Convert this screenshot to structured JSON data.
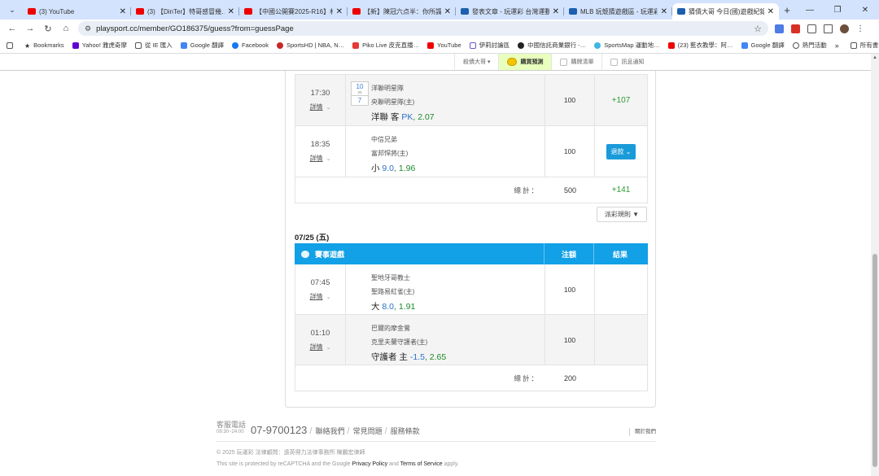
{
  "browser": {
    "tabs": [
      {
        "title": "(3) YouTube",
        "icon": "youtube-icon"
      },
      {
        "title": "(3) 【DinTer】特哥感冒幾…",
        "icon": "youtube-icon"
      },
      {
        "title": "【中國公開賽2025-R16】林俊…",
        "icon": "youtube-icon"
      },
      {
        "title": "【新】陳冠六点半：你所謂打…",
        "icon": "youtube-icon"
      },
      {
        "title": "發表文章 - 玩運彩 台灣運動彩…",
        "icon": "playsport-icon"
      },
      {
        "title": "MLB 玩競猜遊戲區 - 玩運彩…",
        "icon": "playsport-icon"
      },
      {
        "title": "猜債大哥 今日(國)遊戲紀錄 - 玩…",
        "icon": "playsport-icon",
        "active": true
      }
    ],
    "new_tab": "+",
    "url": "playsport.cc/member/GO186375/guess?from=guessPage",
    "bookmarks": [
      "Bookmarks",
      "Yahoo! 雅虎奇摩",
      "從 IE 匯入",
      "Google 翻譯",
      "Facebook",
      "SportsHD | NBA, N…",
      "Piko Live 皮克直播…",
      "YouTube",
      "伊莉討論區",
      "中國信託商業銀行 -…",
      "SportsMap 運動地…",
      "(23) 藍衣教學：阿…",
      "Google 翻譯",
      "熱門活動"
    ],
    "bookmarks_more": "»",
    "all_bookmarks": "所有書籤"
  },
  "subnav": {
    "items": [
      "殺債大哥",
      "購買預測",
      "購牌清單",
      "訊息通知"
    ]
  },
  "day1": {
    "games": [
      {
        "time": "17:30",
        "detail": "詳情",
        "away": "洋聯明星隊",
        "home": "央聯明星隊(主)",
        "score_top": "10",
        "score_vs": "vs",
        "score_bottom": "7",
        "pick_team": "洋聯 客 ",
        "pick_line": "PK",
        "pick_sep": ", ",
        "pick_odds": "2.07",
        "stake": "100",
        "result": "+107"
      },
      {
        "time": "18:35",
        "detail": "詳情",
        "away": "中信兄弟",
        "home": "富邦悍將(主)",
        "pick_team": "小 ",
        "pick_line": "9.0",
        "pick_sep": ", ",
        "pick_odds": "1.96",
        "stake": "100",
        "result_btn": "退款"
      }
    ],
    "total_label": "總計：",
    "total_stake": "500",
    "total_result": "+141"
  },
  "rules_button": "派彩規則 ▼",
  "day2": {
    "date": "07/25 (五)",
    "headers": {
      "game": "賽事遊戲",
      "stake": "注額",
      "result": "結果"
    },
    "games": [
      {
        "time": "07:45",
        "detail": "詳情",
        "away": "聖地牙哥教士",
        "home": "聖路易紅雀(主)",
        "pick_team": "大 ",
        "pick_line": "8.0",
        "pick_sep": ", ",
        "pick_odds": "1.91",
        "stake": "100"
      },
      {
        "time": "01:10",
        "detail": "詳情",
        "away": "巴爾的摩金鶯",
        "home": "克里夫蘭守護者(主)",
        "pick_team": "守護者 主 ",
        "pick_line": "-1.5",
        "pick_sep": ", ",
        "pick_odds": "2.65",
        "stake": "100"
      }
    ],
    "total_label": "總計：",
    "total_stake": "200"
  },
  "footer": {
    "cs_label": "客服電話",
    "cs_hours": "09:30~24:00",
    "phone": "07-9700123",
    "links": [
      "聯絡我們",
      "常見問題",
      "服務條款"
    ],
    "about": "關於我們",
    "copyright": "© 2025 玩運彩 法律顧問：遠英得力法律事務所 陳鵬宏律師",
    "recaptcha_pre": "This site is protected by reCAPTCHA and the Google ",
    "privacy": "Privacy Policy",
    "and": " and ",
    "terms": "Terms of Service",
    "recaptcha_post": " apply."
  }
}
